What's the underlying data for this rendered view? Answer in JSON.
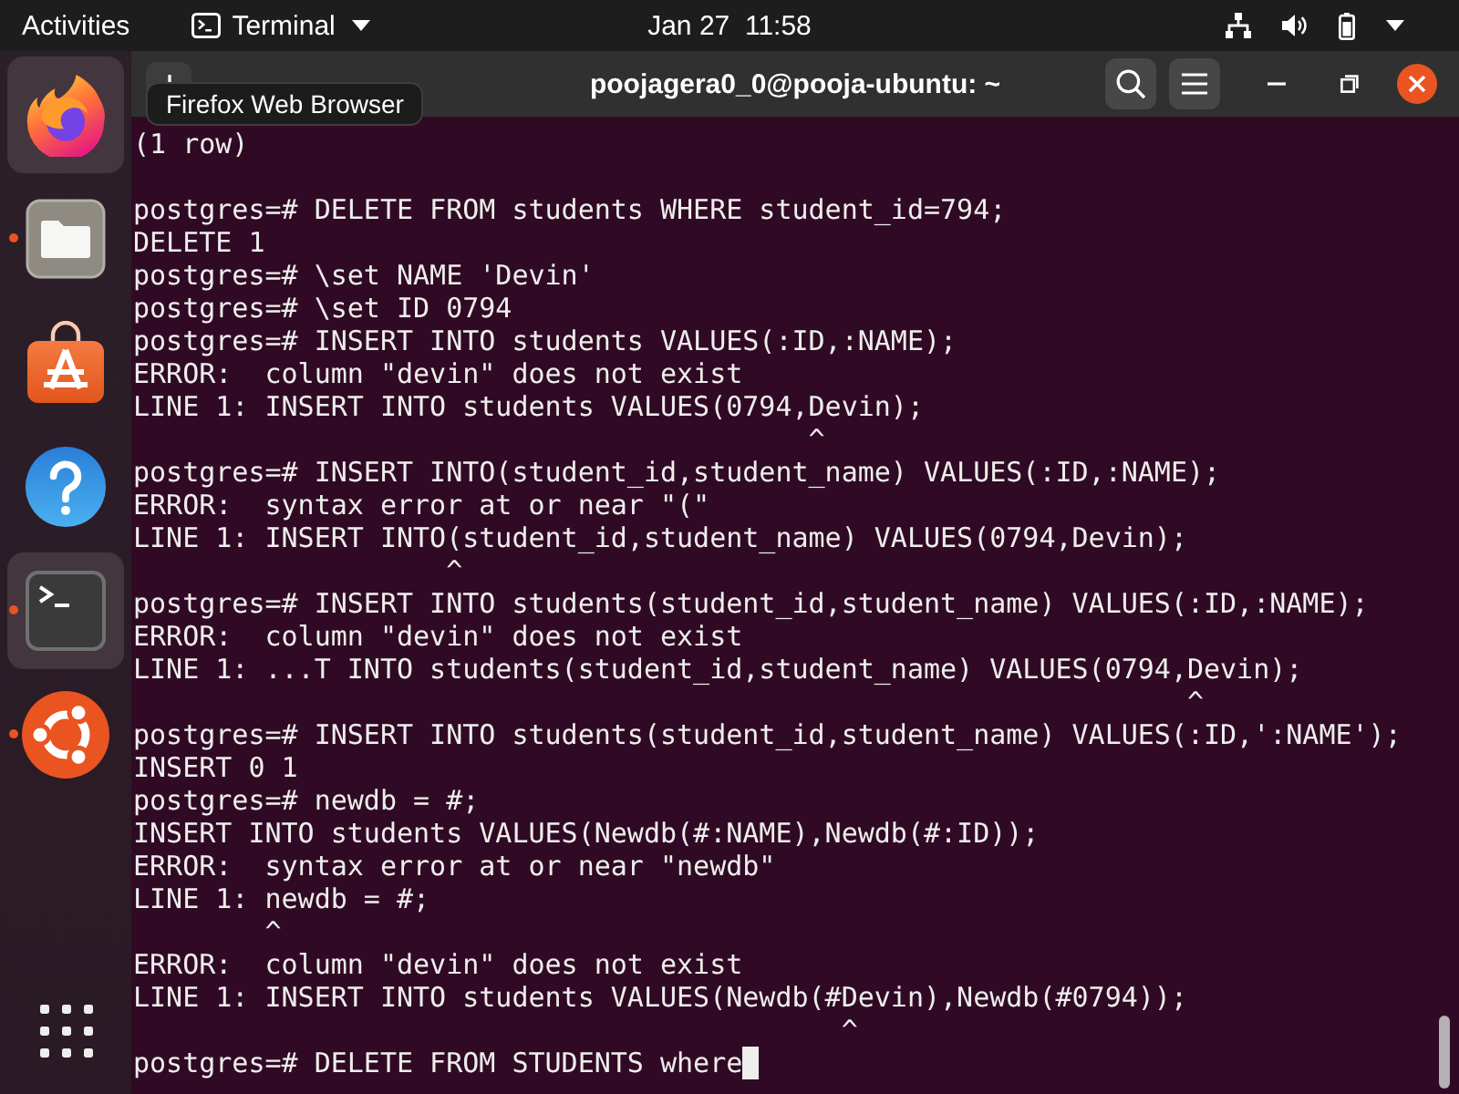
{
  "top_bar": {
    "activities": "Activities",
    "app_menu": "Terminal",
    "clock": "Jan 27  11:58"
  },
  "dock": {
    "items": [
      {
        "kind": "firefox",
        "highlighted": true,
        "running": false
      },
      {
        "kind": "files",
        "highlighted": false,
        "running": true
      },
      {
        "kind": "store",
        "highlighted": false,
        "running": false
      },
      {
        "kind": "help",
        "highlighted": false,
        "running": false
      },
      {
        "kind": "terminal",
        "highlighted": true,
        "running": true
      },
      {
        "kind": "ubuntu",
        "highlighted": false,
        "running": true
      }
    ],
    "tooltip": "Firefox Web Browser"
  },
  "window": {
    "title": "poojagera0_0@pooja-ubuntu: ~"
  },
  "terminal": {
    "blocks": [
      [
        "(1 row)"
      ],
      [
        "postgres=# DELETE FROM students WHERE student_id=794;",
        "DELETE 1",
        "postgres=# \\set NAME 'Devin'",
        "postgres=# \\set ID 0794",
        "postgres=# INSERT INTO students VALUES(:ID,:NAME);",
        "ERROR:  column \"devin\" does not exist",
        "LINE 1: INSERT INTO students VALUES(0794,Devin);",
        "                                         ^",
        "postgres=# INSERT INTO(student_id,student_name) VALUES(:ID,:NAME);",
        "ERROR:  syntax error at or near \"(\"",
        "LINE 1: INSERT INTO(student_id,student_name) VALUES(0794,Devin);",
        "                   ^",
        "postgres=# INSERT INTO students(student_id,student_name) VALUES(:ID,:NAME);",
        "ERROR:  column \"devin\" does not exist",
        "LINE 1: ...T INTO students(student_id,student_name) VALUES(0794,Devin);",
        "                                                                ^",
        "postgres=# INSERT INTO students(student_id,student_name) VALUES(:ID,':NAME');",
        "INSERT 0 1",
        "postgres=# newdb = #;",
        "INSERT INTO students VALUES(Newdb(#:NAME),Newdb(#:ID));",
        "ERROR:  syntax error at or near \"newdb\"",
        "LINE 1: newdb = #;",
        "        ^",
        "ERROR:  column \"devin\" does not exist",
        "LINE 1: INSERT INTO students VALUES(Newdb(#Devin),Newdb(#0794));",
        "                                           ^",
        "postgres=# DELETE FROM STUDENTS where"
      ]
    ],
    "cursor": true
  }
}
